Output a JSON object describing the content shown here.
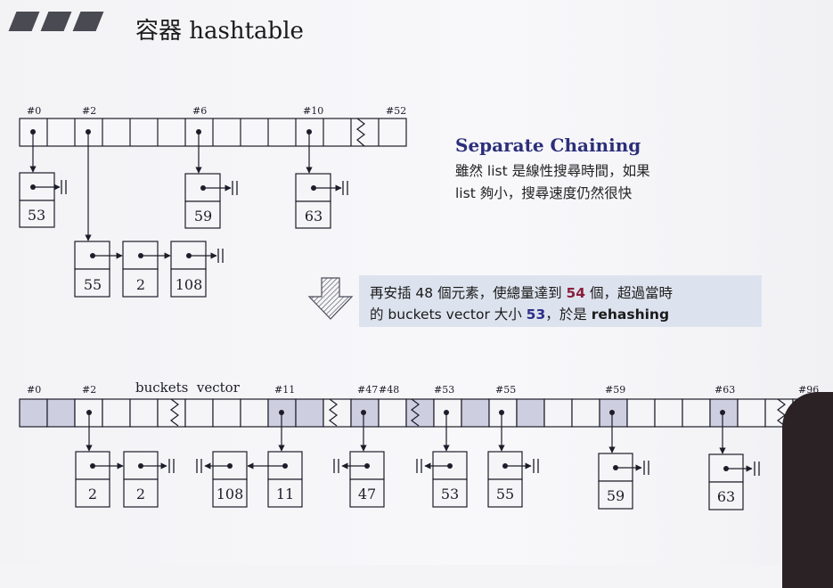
{
  "title": "容器 hashtable",
  "separate_chaining": {
    "heading": "Separate Chaining",
    "line1": "雖然 list 是線性搜尋時間，如果",
    "line2": "list 夠小，搜尋速度仍然很快"
  },
  "callout": {
    "line1_a": "再安插 48 個元素，使總量達到 ",
    "line1_num": "54",
    "line1_b": " 個，超過當時",
    "line2_a": "的 buckets vector 大小 ",
    "line2_num": "53",
    "line2_b": "，於是 ",
    "line2_word": "rehashing"
  },
  "top_table": {
    "labels": [
      "#0",
      "#2",
      "#6",
      "#10",
      "#52"
    ],
    "chains": {
      "bucket0": [
        "53"
      ],
      "bucket2": [
        "55",
        "2",
        "108"
      ],
      "bucket6": [
        "59"
      ],
      "bucket10": [
        "63"
      ]
    }
  },
  "bottom_table": {
    "caption": "buckets  vector",
    "labels": [
      "#0",
      "#2",
      "#11",
      "#47",
      "#48",
      "#53",
      "#55",
      "#59",
      "#63",
      "#96"
    ],
    "values": [
      "2",
      "2",
      "108",
      "11",
      "47",
      "53",
      "55",
      "59",
      "63"
    ]
  },
  "colors": {
    "cell_fill": "#f5f5f7",
    "cell_highlight": "#cdcee0",
    "line": "#1d1d2a",
    "heading_blue": "#2b2f7a",
    "accent_red": "#8a1f3c",
    "callout_bg": "#dde3ee"
  },
  "icons": [
    "rehash-down-arrow-icon",
    "null-terminator-icon",
    "break-squiggle-icon"
  ]
}
